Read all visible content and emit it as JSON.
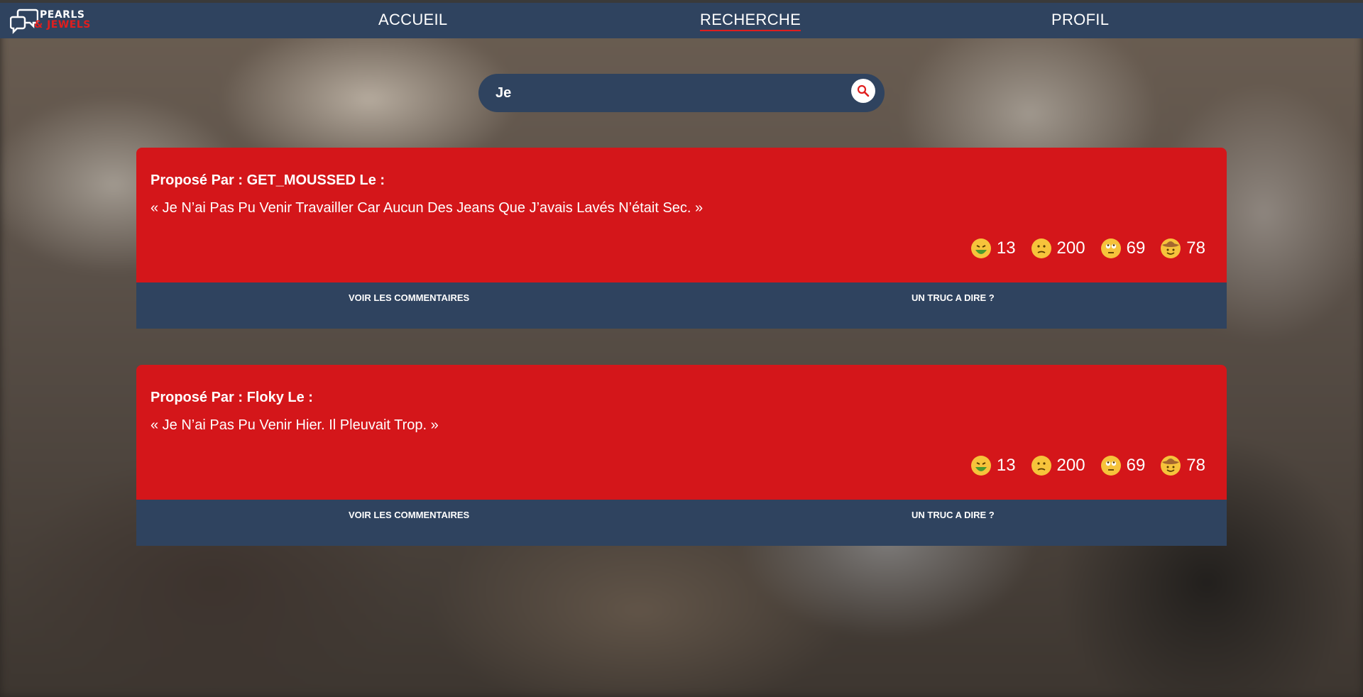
{
  "app": {
    "logo_line1": "PEARLS",
    "logo_line2": "& JEWELS"
  },
  "nav": {
    "home": "ACCUEIL",
    "search": "RECHERCHE",
    "profile": "PROFIL"
  },
  "search": {
    "value": "Je",
    "placeholder": ""
  },
  "posts": [
    {
      "author": "Proposé Par : GET_MOUSSED Le :",
      "quote": "« Je N’ai Pas Pu Venir Travailler Car Aucun Des Jeans Que J’avais Lavés N’était Sec. »",
      "reactions": [
        {
          "icon": "nauseated-face-icon",
          "count": "13"
        },
        {
          "icon": "confused-face-icon",
          "count": "200"
        },
        {
          "icon": "eye-roll-face-icon",
          "count": "69"
        },
        {
          "icon": "cowboy-face-icon",
          "count": "78"
        }
      ],
      "comments_label": "VOIR LES COMMENTAIRES",
      "say_label": "UN TRUC A DIRE ?"
    },
    {
      "author": "Proposé Par : Floky Le :",
      "quote": "« Je N’ai Pas Pu Venir Hier. Il Pleuvait Trop. »",
      "reactions": [
        {
          "icon": "nauseated-face-icon",
          "count": "13"
        },
        {
          "icon": "confused-face-icon",
          "count": "200"
        },
        {
          "icon": "eye-roll-face-icon",
          "count": "69"
        },
        {
          "icon": "cowboy-face-icon",
          "count": "78"
        }
      ],
      "comments_label": "VOIR LES COMMENTAIRES",
      "say_label": "UN TRUC A DIRE ?"
    }
  ],
  "colors": {
    "navy": "#2f435f",
    "red": "#d4161a",
    "accent_red": "#e01e1e"
  }
}
